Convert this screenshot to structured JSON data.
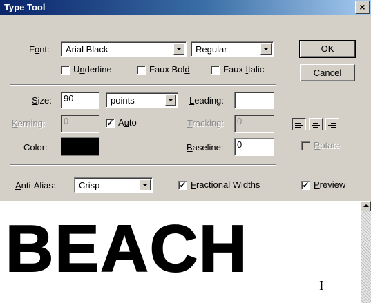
{
  "window": {
    "title": "Type Tool",
    "close_glyph": "×"
  },
  "font": {
    "label_pre": "F",
    "label_ul": "o",
    "label_post": "nt:",
    "family": "Arial Black",
    "style": "Regular"
  },
  "checkboxes": {
    "underline": {
      "pre": "U",
      "ul": "n",
      "post": "derline",
      "checked": false
    },
    "faux_bold": {
      "pre": "Faux Bol",
      "ul": "d",
      "post": "",
      "checked": false
    },
    "faux_italic": {
      "pre": "Faux ",
      "ul": "I",
      "post": "talic",
      "checked": false
    },
    "auto": {
      "pre": "A",
      "ul": "u",
      "post": "to",
      "checked": true
    },
    "rotate": {
      "pre": "",
      "ul": "R",
      "post": "otate",
      "checked": false
    },
    "fractional_widths": {
      "pre": "",
      "ul": "F",
      "post": "ractional Widths",
      "checked": true
    },
    "preview": {
      "pre": "",
      "ul": "P",
      "post": "review",
      "checked": true
    }
  },
  "buttons": {
    "ok": "OK",
    "cancel": "Cancel"
  },
  "size": {
    "label_pre": "",
    "label_ul": "S",
    "label_post": "ize:",
    "value": "90",
    "unit": "points"
  },
  "leading": {
    "label_pre": "",
    "label_ul": "L",
    "label_post": "eading:",
    "value": ""
  },
  "kerning": {
    "label_pre": "",
    "label_ul": "K",
    "label_post": "erning:",
    "value": "0"
  },
  "tracking": {
    "label_pre": "",
    "label_ul": "T",
    "label_post": "racking:",
    "value": "0"
  },
  "color": {
    "label": "Color:",
    "swatch": "#000000"
  },
  "baseline": {
    "label_pre": "",
    "label_ul": "B",
    "label_post": "aseline:",
    "value": "0"
  },
  "anti_alias": {
    "label_pre": "",
    "label_ul": "A",
    "label_post": "nti-Alias:",
    "value": "Crisp"
  },
  "alignment": {
    "options": [
      "align-left",
      "align-center",
      "align-right"
    ],
    "selected": "align-left"
  },
  "preview": {
    "text": "BEACH",
    "cursor_glyph": "I"
  },
  "colors": {
    "titlebar_start": "#0a246a",
    "titlebar_end": "#a6caf0",
    "dialog_bg": "#d4d0c8"
  }
}
